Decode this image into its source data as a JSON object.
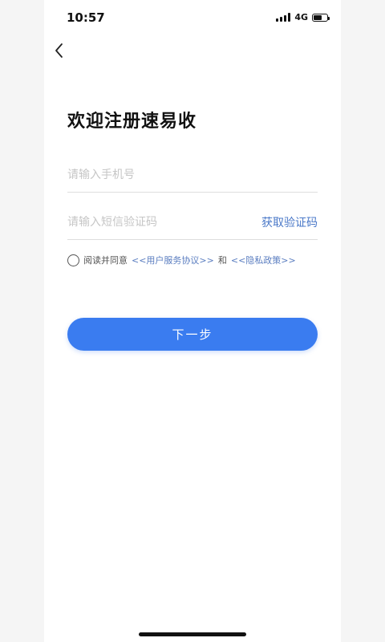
{
  "status_bar": {
    "time": "10:57",
    "network": "4G",
    "battery_level": 0.6
  },
  "header": {
    "back_icon": "chevron-left-icon",
    "title": "欢迎注册速易收"
  },
  "form": {
    "phone_placeholder": "请输入手机号",
    "phone_value": "",
    "code_placeholder": "请输入短信验证码",
    "code_value": "",
    "get_code_label": "获取验证码"
  },
  "agreement": {
    "checked": false,
    "prefix": "阅读并同意",
    "user_agreement": "<<用户服务协议>>",
    "and": "和",
    "privacy_policy": "<<隐私政策>>"
  },
  "actions": {
    "next_label": "下一步"
  },
  "colors": {
    "primary": "#3a7cf0",
    "link": "#5a7dc0"
  }
}
